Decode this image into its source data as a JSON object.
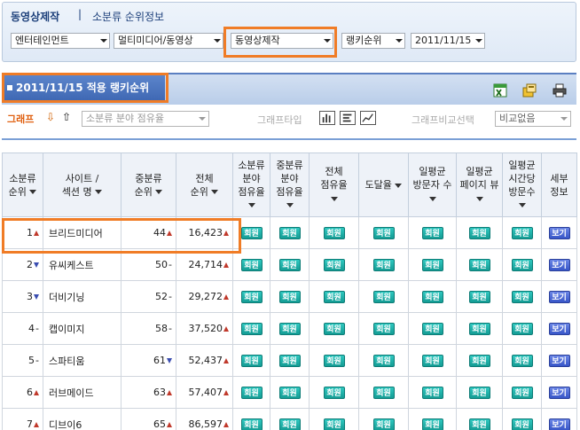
{
  "header": {
    "title": "동영상제작",
    "separator": "|",
    "subtitle": "소분류 순위정보"
  },
  "filters": {
    "category1": "엔터테인먼트",
    "category2": "멀티미디어/동영상",
    "category3": "동영상제작",
    "ranking_type": "랭키순위",
    "date": "2011/11/15"
  },
  "ranking_tab": {
    "label": "2011/11/15 적용 랭키순위"
  },
  "toolbar": {
    "icons": [
      "excel-icon",
      "save-icon",
      "print-icon"
    ]
  },
  "graph_row": {
    "graph_label": "그래프",
    "graph_select_value": "소분류 분야 점유율",
    "graph_type_label": "그래프타입",
    "compare_label": "그래프비교선택",
    "compare_value": "비교없음"
  },
  "colors": {
    "accent": "#f07c26",
    "header_blue": "#3e67b3",
    "member_button": "#149c94",
    "view_button": "#3856c8",
    "rank_up": "#c0392b",
    "rank_down": "#3a4db0"
  },
  "table": {
    "headers": {
      "rank": [
        "소분류",
        "순위"
      ],
      "site": [
        "사이트 /",
        "섹션 명"
      ],
      "mid_rank": [
        "중분류",
        "순위"
      ],
      "total_rank": [
        "전체",
        "순위"
      ],
      "sub_share": [
        "소분류",
        "분야",
        "점유율"
      ],
      "mid_share": [
        "중분류",
        "분야",
        "점유율"
      ],
      "total_share": [
        "전체",
        "점유율"
      ],
      "reach": "도달율",
      "daily_visitors": [
        "일평균",
        "방문자 수"
      ],
      "daily_pageviews": [
        "일평균",
        "페이지 뷰"
      ],
      "daily_time": [
        "일평균",
        "시간당",
        "방문수"
      ],
      "detail": [
        "세부",
        "정보"
      ]
    },
    "member_label": "회원",
    "view_label": "보기",
    "rows": [
      {
        "rank": "1",
        "rank_dir": "up",
        "site": "브리드미디어",
        "mid_rank": "44",
        "mid_dir": "up",
        "total_rank": "16,423",
        "total_dir": "up"
      },
      {
        "rank": "2",
        "rank_dir": "down",
        "site": "유씨케스트",
        "mid_rank": "50",
        "mid_dir": "same",
        "total_rank": "24,714",
        "total_dir": "up"
      },
      {
        "rank": "3",
        "rank_dir": "down",
        "site": "더비기닝",
        "mid_rank": "52",
        "mid_dir": "same",
        "total_rank": "29,272",
        "total_dir": "up"
      },
      {
        "rank": "4",
        "rank_dir": "same",
        "site": "캡이미지",
        "mid_rank": "58",
        "mid_dir": "same",
        "total_rank": "37,520",
        "total_dir": "up"
      },
      {
        "rank": "5",
        "rank_dir": "same",
        "site": "스파티움",
        "mid_rank": "61",
        "mid_dir": "down",
        "total_rank": "52,437",
        "total_dir": "up"
      },
      {
        "rank": "6",
        "rank_dir": "up",
        "site": "러브메이드",
        "mid_rank": "63",
        "mid_dir": "up",
        "total_rank": "57,407",
        "total_dir": "up"
      },
      {
        "rank": "7",
        "rank_dir": "up",
        "site": "디브이6",
        "mid_rank": "65",
        "mid_dir": "up",
        "total_rank": "86,597",
        "total_dir": "up"
      }
    ]
  }
}
